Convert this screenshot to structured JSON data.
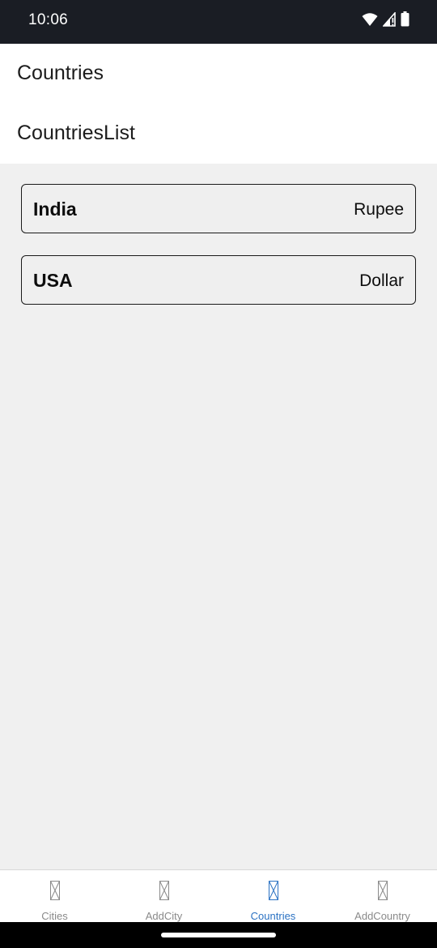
{
  "status_bar": {
    "time": "10:06",
    "icons": [
      "wifi-icon",
      "cell-signal-icon",
      "battery-icon"
    ]
  },
  "header": {
    "title": "Countries"
  },
  "sub_header": {
    "title": "CountriesList"
  },
  "countries": [
    {
      "name": "India",
      "currency": "Rupee"
    },
    {
      "name": "USA",
      "currency": "Dollar"
    }
  ],
  "tabs": [
    {
      "label": "Cities",
      "icon": "placeholder-icon",
      "active": false
    },
    {
      "label": "AddCity",
      "icon": "placeholder-icon",
      "active": false
    },
    {
      "label": "Countries",
      "icon": "placeholder-icon",
      "active": true
    },
    {
      "label": "AddCountry",
      "icon": "placeholder-icon",
      "active": false
    }
  ],
  "colors": {
    "status_bar_bg": "#1a1d24",
    "content_bg": "#f0f0f0",
    "active_tab": "#2b72c3",
    "inactive_tab": "#8a8a8a"
  }
}
